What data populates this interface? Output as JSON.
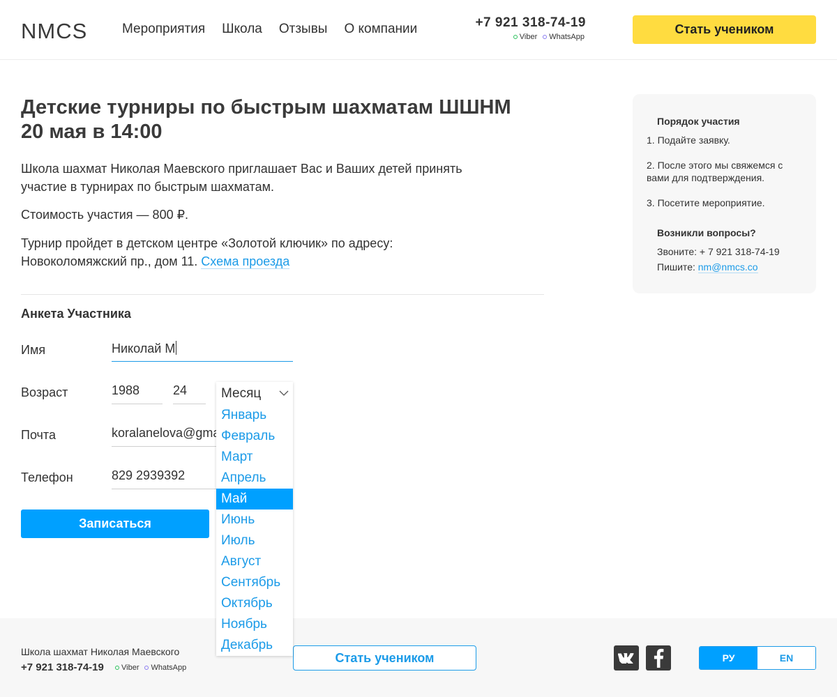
{
  "header": {
    "logo": "NMCS",
    "nav": [
      "Мероприятия",
      "Школа",
      "Отзывы",
      "О компании"
    ],
    "phone": "+7 921 318-74-19",
    "viber": "Viber",
    "whatsapp": "WhatsApp",
    "cta": "Стать учеником"
  },
  "main": {
    "title": "Детские турниры по быстрым шахматам ШШНМ 20 мая в 14:00",
    "intro": "Школа шахмат Николая Маевского приглашает Вас и Ваших детей принять участие в турнирах по быстрым шахматам.",
    "price": "Стоимость участия — 800 ₽.",
    "address": "Турнир пройдет в детском центре «Золотой ключик» по адресу: Новоколомяжский пр., дом 11.",
    "map_link": "Схема проезда"
  },
  "form": {
    "title": "Анкета Участника",
    "name_label": "Имя",
    "name_value": "Николай М",
    "age_label": "Возраст",
    "year_value": "1988",
    "day_value": "24",
    "email_label": "Почта",
    "email_value": "koralanelova@gmail.com",
    "phone_label": "Телефон",
    "phone_value": "829 2939392",
    "submit": "Записаться"
  },
  "month_dropdown": {
    "placeholder": "Месяц",
    "selected": "Май",
    "options": [
      "Январь",
      "Февраль",
      "Март",
      "Апрель",
      "Май",
      "Июнь",
      "Июль",
      "Август",
      "Сентябрь",
      "Октябрь",
      "Ноябрь",
      "Декабрь"
    ]
  },
  "sidebar": {
    "steps_title": "Порядок участия",
    "steps": [
      "1. Подайте заявку.",
      "2. После этого мы свяжемся с вами для подтверждения.",
      "3. Посетите мероприятие."
    ],
    "questions_title": "Возникли вопросы?",
    "call": "Звоните: + 7 921 318-74-19",
    "write_label": "Пишите:",
    "email": "nm@nmcs.co"
  },
  "footer": {
    "school": "Школа шахмат Николая Маевского",
    "phone": "+7 921 318-74-19",
    "viber": "Viber",
    "whatsapp": "WhatsApp",
    "cta": "Стать учеником",
    "lang_ru": "РУ",
    "lang_en": "EN"
  },
  "colors": {
    "accent_blue": "#00a0ff",
    "link_blue": "#1c9be8",
    "cta_yellow": "#ffdc40"
  }
}
